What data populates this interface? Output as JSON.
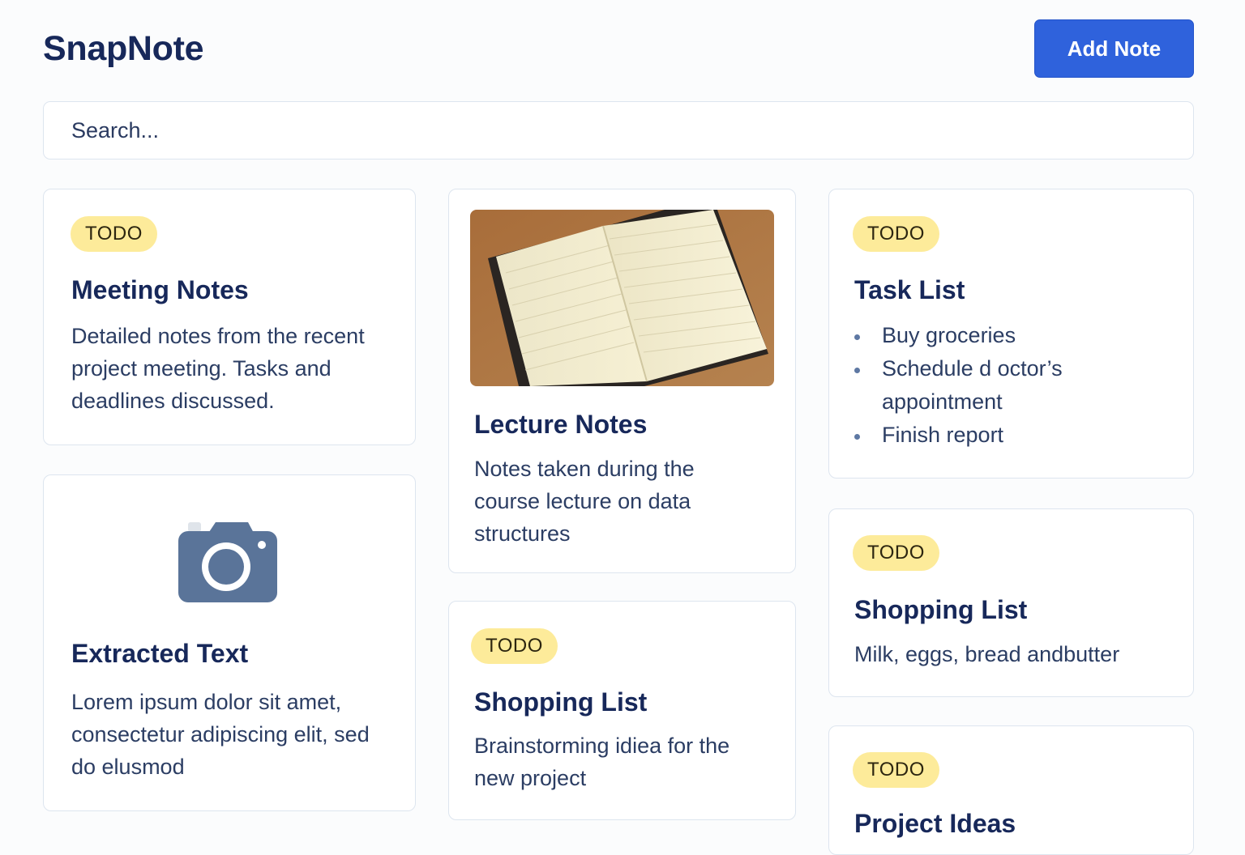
{
  "app": {
    "title": "SnapNote"
  },
  "toolbar": {
    "add_label": "Add Note"
  },
  "search": {
    "placeholder": "Search..."
  },
  "cards": {
    "meeting": {
      "badge": "TODO",
      "title": "Meeting Notes",
      "body": "Detailed notes from the recent project meeting. Tasks and deadlines discussed."
    },
    "extracted": {
      "icon": "camera-icon",
      "title": "Extracted Text",
      "body": "Lorem ipsum dolor sit amet, consectetur adipiscing elit, sed do elusmod"
    },
    "lecture": {
      "image": "open-notebook-photo",
      "title": "Lecture Notes",
      "body": "Notes taken during the course lecture on data structures"
    },
    "brainstorm": {
      "badge": "TODO",
      "title": "Shopping List",
      "body": "Brainstorming idiea for the new project"
    },
    "tasks": {
      "badge": "TODO",
      "title": "Task List",
      "items": [
        "Buy groceries",
        "Schedule d octor’s appointment",
        "Finish report"
      ]
    },
    "shopping": {
      "badge": "TODO",
      "title": "Shopping List",
      "body": "Milk, eggs, bread andbutter"
    },
    "ideas": {
      "badge": "TODO",
      "title": "Project Ideas"
    }
  },
  "colors": {
    "accent": "#2f62dc",
    "badge_bg": "#fdeb9a",
    "title": "#17285a",
    "camera": "#5a7499"
  }
}
